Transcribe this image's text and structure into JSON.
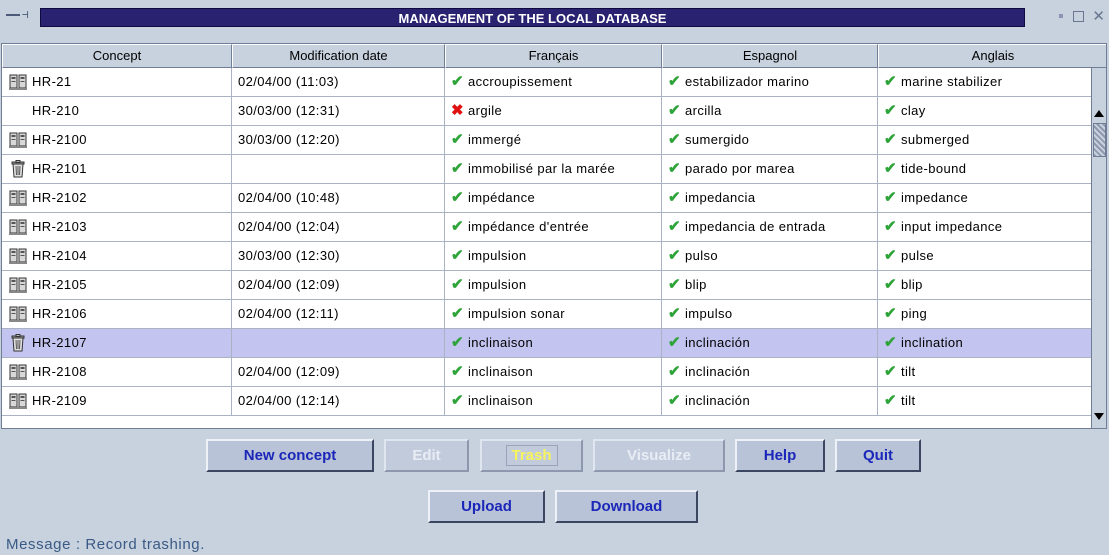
{
  "window": {
    "title": "MANAGEMENT OF THE LOCAL DATABASE"
  },
  "table": {
    "columns": [
      "Concept",
      "Modification date",
      "Français",
      "Espagnol",
      "Anglais"
    ],
    "rows": [
      {
        "icon": "server-icon",
        "concept": "HR-21",
        "date": "02/04/00 (11:03)",
        "fr_status": "check",
        "fr": "accroupissement",
        "es_status": "check",
        "es": "estabilizador marino",
        "en_status": "check",
        "en": "marine stabilizer",
        "selected": false
      },
      {
        "icon": "",
        "concept": "HR-210",
        "date": "30/03/00 (12:31)",
        "fr_status": "cross",
        "fr": "argile",
        "es_status": "check",
        "es": "arcilla",
        "en_status": "check",
        "en": "clay",
        "selected": false
      },
      {
        "icon": "server-icon",
        "concept": "HR-2100",
        "date": "30/03/00 (12:20)",
        "fr_status": "check",
        "fr": "immergé",
        "es_status": "check",
        "es": "sumergido",
        "en_status": "check",
        "en": "submerged",
        "selected": false
      },
      {
        "icon": "trash-icon",
        "concept": "HR-2101",
        "date": "",
        "fr_status": "check",
        "fr": "immobilisé par la marée",
        "es_status": "check",
        "es": "parado por marea",
        "en_status": "check",
        "en": "tide-bound",
        "selected": false
      },
      {
        "icon": "server-icon",
        "concept": "HR-2102",
        "date": "02/04/00 (10:48)",
        "fr_status": "check",
        "fr": "impédance",
        "es_status": "check",
        "es": "impedancia",
        "en_status": "check",
        "en": "impedance",
        "selected": false
      },
      {
        "icon": "server-icon",
        "concept": "HR-2103",
        "date": "02/04/00 (12:04)",
        "fr_status": "check",
        "fr": "impédance d'entrée",
        "es_status": "check",
        "es": "impedancia de entrada",
        "en_status": "check",
        "en": "input impedance",
        "selected": false
      },
      {
        "icon": "server-icon",
        "concept": "HR-2104",
        "date": "30/03/00 (12:30)",
        "fr_status": "check",
        "fr": "impulsion",
        "es_status": "check",
        "es": "pulso",
        "en_status": "check",
        "en": "pulse",
        "selected": false
      },
      {
        "icon": "server-icon",
        "concept": "HR-2105",
        "date": "02/04/00 (12:09)",
        "fr_status": "check",
        "fr": "impulsion",
        "es_status": "check",
        "es": "blip",
        "en_status": "check",
        "en": "blip",
        "selected": false
      },
      {
        "icon": "server-icon",
        "concept": "HR-2106",
        "date": "02/04/00 (12:11)",
        "fr_status": "check",
        "fr": "impulsion sonar",
        "es_status": "check",
        "es": "impulso",
        "en_status": "check",
        "en": "ping",
        "selected": false
      },
      {
        "icon": "trash-icon",
        "concept": "HR-2107",
        "date": "",
        "fr_status": "check",
        "fr": "inclinaison",
        "es_status": "check",
        "es": "inclinación",
        "en_status": "check",
        "en": "inclination",
        "selected": true
      },
      {
        "icon": "server-icon",
        "concept": "HR-2108",
        "date": "02/04/00 (12:09)",
        "fr_status": "check",
        "fr": "inclinaison",
        "es_status": "check",
        "es": "inclinación",
        "en_status": "check",
        "en": "tilt",
        "selected": false
      },
      {
        "icon": "server-icon",
        "concept": "HR-2109",
        "date": "02/04/00 (12:14)",
        "fr_status": "check",
        "fr": "inclinaison",
        "es_status": "check",
        "es": "inclinación",
        "en_status": "check",
        "en": "tilt",
        "selected": false
      }
    ]
  },
  "buttons": {
    "new_concept": "New concept",
    "edit": "Edit",
    "trash": "Trash",
    "visualize": "Visualize",
    "help": "Help",
    "quit": "Quit",
    "upload": "Upload",
    "download": "Download"
  },
  "status": {
    "message": "Message :   Record trashing."
  },
  "colors": {
    "title_bg": "#282270",
    "selected_row": "#c3c5f0",
    "button_text": "#1b27b8",
    "check": "#2fa43a",
    "cross": "#e01010"
  }
}
